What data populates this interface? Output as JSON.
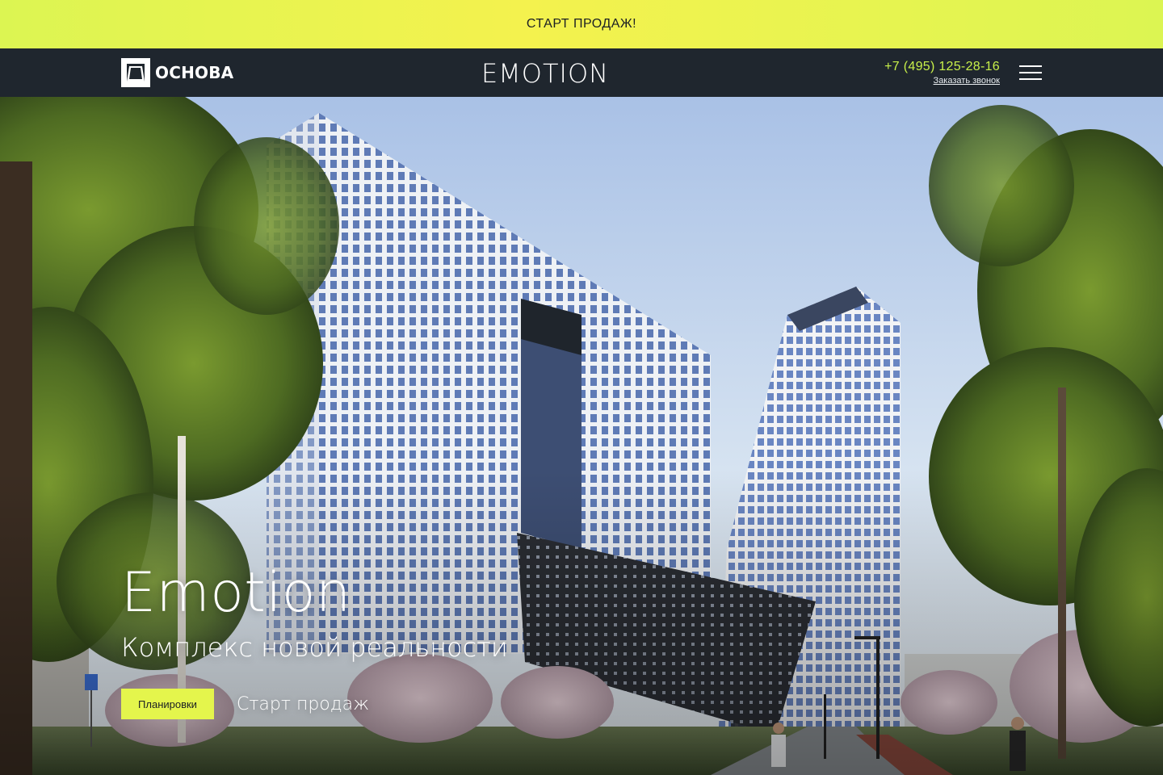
{
  "promo_banner": {
    "text": "СТАРТ ПРОДАЖ!"
  },
  "header": {
    "brand_name": "ОСНОВА",
    "project_logo": "EMOTION",
    "phone": "+7 (495) 125-28-16",
    "callback_label": "Заказать звонок",
    "menu_icon": "hamburger-menu-icon"
  },
  "hero": {
    "title": "Emotion",
    "subtitle": "Комплекс новой реальности",
    "plans_button": "Планировки",
    "sales_link": "Старт продаж"
  },
  "colors": {
    "accent": "#e4f54c",
    "phone": "#c8f04a",
    "header_bg": "#1f262e"
  }
}
